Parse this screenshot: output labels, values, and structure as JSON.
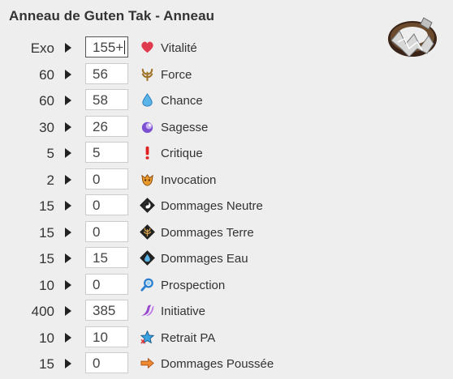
{
  "title": "Anneau de Guten Tak - Anneau",
  "item_image": "ring-image",
  "stats": [
    {
      "max": "Exo",
      "value": "155+",
      "label": "Vitalité",
      "icon": "heart-icon",
      "color": "#e03a4e",
      "focused": true
    },
    {
      "max": "60",
      "value": "56",
      "label": "Force",
      "icon": "strength-icon",
      "color": "#b07a2a"
    },
    {
      "max": "60",
      "value": "58",
      "label": "Chance",
      "icon": "water-drop-icon",
      "color": "#4aa3df"
    },
    {
      "max": "30",
      "value": "26",
      "label": "Sagesse",
      "icon": "wisdom-icon",
      "color": "#8a5ad8"
    },
    {
      "max": "5",
      "value": "5",
      "label": "Critique",
      "icon": "critical-icon",
      "color": "#e02020"
    },
    {
      "max": "2",
      "value": "0",
      "label": "Invocation",
      "icon": "summon-icon",
      "color": "#d88a1a"
    },
    {
      "max": "15",
      "value": "0",
      "label": "Dommages Neutre",
      "icon": "neutral-damage-icon",
      "color": "#222222"
    },
    {
      "max": "15",
      "value": "0",
      "label": "Dommages Terre",
      "icon": "earth-damage-icon",
      "color": "#222222"
    },
    {
      "max": "15",
      "value": "15",
      "label": "Dommages Eau",
      "icon": "water-damage-icon",
      "color": "#222222"
    },
    {
      "max": "10",
      "value": "0",
      "label": "Prospection",
      "icon": "prospecting-icon",
      "color": "#2a7fd0"
    },
    {
      "max": "400",
      "value": "385",
      "label": "Initiative",
      "icon": "initiative-icon",
      "color": "#9a48d0"
    },
    {
      "max": "10",
      "value": "10",
      "label": "Retrait PA",
      "icon": "ap-reduction-icon",
      "color": "#2a9ad8"
    },
    {
      "max": "15",
      "value": "0",
      "label": "Dommages Poussée",
      "icon": "pushback-damage-icon",
      "color": "#f08a30"
    }
  ]
}
